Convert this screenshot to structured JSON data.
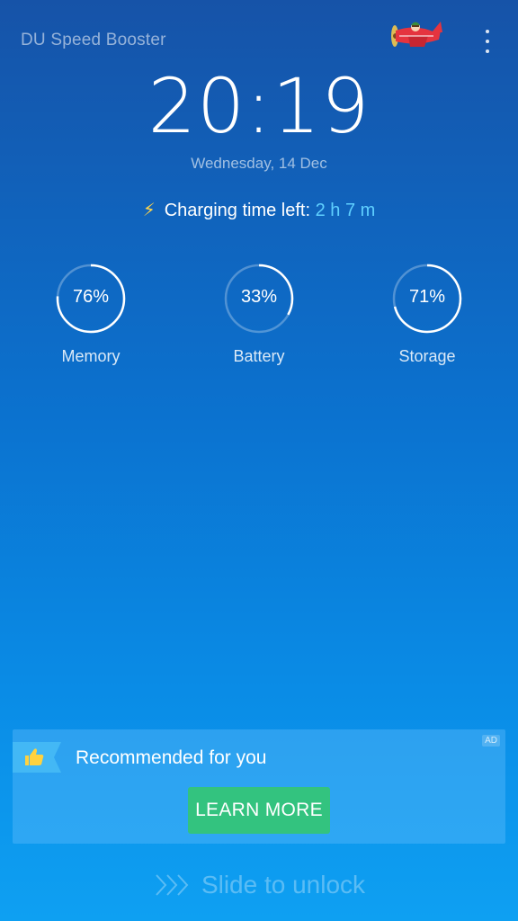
{
  "header": {
    "app_title": "DU Speed Booster",
    "plane_icon": "airplane-mascot-icon",
    "menu_icon": "more-vertical-icon"
  },
  "clock": {
    "time": "20:19",
    "date": "Wednesday, 14 Dec"
  },
  "charging": {
    "icon": "lightning-bolt-icon",
    "label": "Charging time left: ",
    "time_left": "2 h 7 m"
  },
  "stats": [
    {
      "value": "76%",
      "fraction": 0.76,
      "label": "Memory"
    },
    {
      "value": "33%",
      "fraction": 0.33,
      "label": "Battery"
    },
    {
      "value": "71%",
      "fraction": 0.71,
      "label": "Storage"
    }
  ],
  "ad": {
    "badge": "AD",
    "ribbon_icon": "thumbs-up-icon",
    "title": "Recommended for you",
    "cta_label": "LEARN MORE"
  },
  "unlock": {
    "icon": "chevrons-right-icon",
    "label": "Slide to unlock"
  },
  "colors": {
    "charging_time": "#5fd0ff",
    "cta_green": "#33c37f",
    "bolt_yellow": "#ffd54a"
  }
}
